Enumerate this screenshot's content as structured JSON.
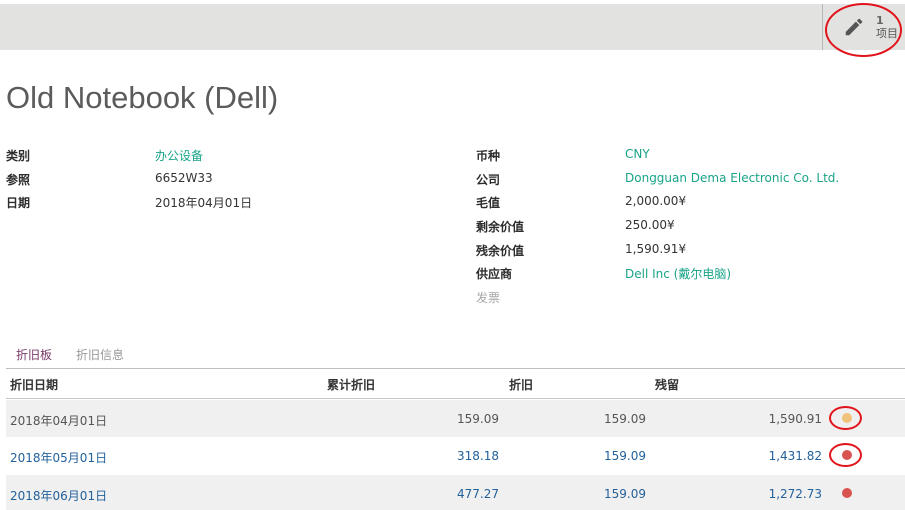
{
  "smart_button": {
    "count": "1",
    "label": "项目",
    "icon": "pencil-icon"
  },
  "title": "Old Notebook (Dell)",
  "left_fields": [
    {
      "label": "类别",
      "value": "办公设备"
    },
    {
      "label": "参照",
      "value": "6652W33"
    },
    {
      "label": "日期",
      "value": "2018年04月01日"
    }
  ],
  "right_fields": [
    {
      "label": "币种",
      "value": "CNY"
    },
    {
      "label": "公司",
      "value": "Dongguan Dema Electronic Co. Ltd."
    },
    {
      "label": "毛值",
      "value": "2,000.00¥"
    },
    {
      "label": "剩余价值",
      "value": "250.00¥"
    },
    {
      "label": "残余价值",
      "value": "1,590.91¥"
    },
    {
      "label": "供应商",
      "value": "Dell Inc (戴尔电脑)"
    },
    {
      "label": "发票",
      "value": ""
    }
  ],
  "tabs": [
    "折旧板",
    "折旧信息"
  ],
  "table": {
    "headers": [
      "折旧日期",
      "累计折旧",
      "折旧",
      "残留"
    ],
    "rows": [
      {
        "date": "2018年04月01日",
        "accumulated": "159.09",
        "depreciation": "159.09",
        "remaining": "1,590.91",
        "status_color": "#f0c27a"
      },
      {
        "date": "2018年05月01日",
        "accumulated": "318.18",
        "depreciation": "159.09",
        "remaining": "1,431.82",
        "status_color": "#d9534f"
      },
      {
        "date": "2018年06月01日",
        "accumulated": "477.27",
        "depreciation": "159.09",
        "remaining": "1,272.73",
        "status_color": "#d9534f"
      }
    ]
  },
  "colors": {
    "link": "#19a388",
    "active_tab": "#7a3b6a",
    "annotation": "#e2141b"
  }
}
